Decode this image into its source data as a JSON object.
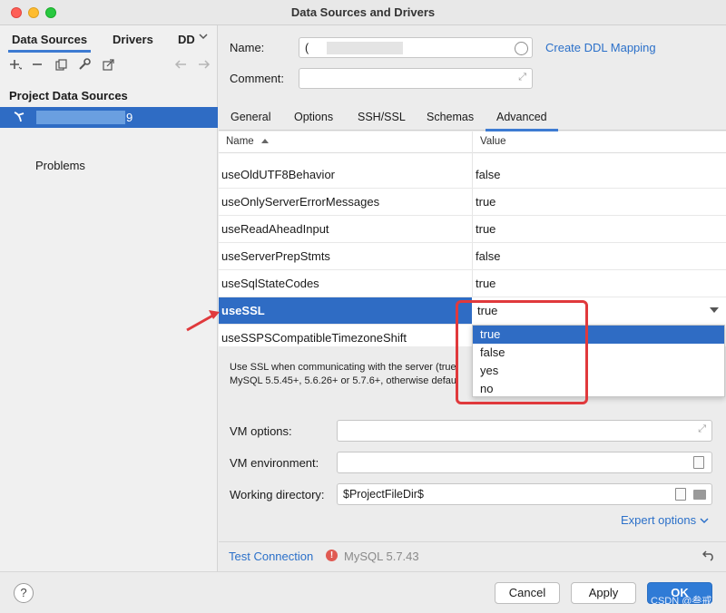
{
  "window": {
    "title": "Data Sources and Drivers"
  },
  "left": {
    "tabs": [
      "Data Sources",
      "Drivers",
      "DD"
    ],
    "section_title": "Project Data Sources",
    "datasource_label_visible": "9",
    "problems": "Problems"
  },
  "form": {
    "name_label": "Name:",
    "name_value": "(",
    "create_ddl": "Create DDL Mapping",
    "comment_label": "Comment:"
  },
  "tabs": [
    "General",
    "Options",
    "SSH/SSL",
    "Schemas",
    "Advanced"
  ],
  "table": {
    "col_name": "Name",
    "col_value": "Value",
    "rows": [
      {
        "name": "useOldUTF8Behavior",
        "value": "false"
      },
      {
        "name": "useOnlyServerErrorMessages",
        "value": "true"
      },
      {
        "name": "useReadAheadInput",
        "value": "true"
      },
      {
        "name": "useServerPrepStmts",
        "value": "false"
      },
      {
        "name": "useSqlStateCodes",
        "value": "true"
      },
      {
        "name": "useSSL",
        "value": "true"
      },
      {
        "name": "useSSPSCompatibleTimezoneShift",
        "value": ""
      }
    ]
  },
  "description": {
    "line1": "Use SSL when communicating with the server (true",
    "line2": "MySQL 5.5.45+, 5.6.26+ or 5.7.6+, otherwise defau"
  },
  "dropdown": {
    "options": [
      "true",
      "false",
      "yes",
      "no"
    ],
    "selected": "true"
  },
  "vm": {
    "options_label": "VM options:",
    "env_label": "VM environment:",
    "workdir_label": "Working directory:",
    "workdir_value": "$ProjectFileDir$"
  },
  "expert_options": "Expert options",
  "status": {
    "test_connection": "Test Connection",
    "version": "MySQL 5.7.43"
  },
  "buttons": {
    "cancel": "Cancel",
    "apply": "Apply",
    "ok": "OK",
    "help": "?"
  },
  "watermark": "CSDN @叁戒",
  "colors": {
    "accent": "#2f6cc4",
    "highlight_box": "#e0393c",
    "link": "#2b70c9"
  }
}
